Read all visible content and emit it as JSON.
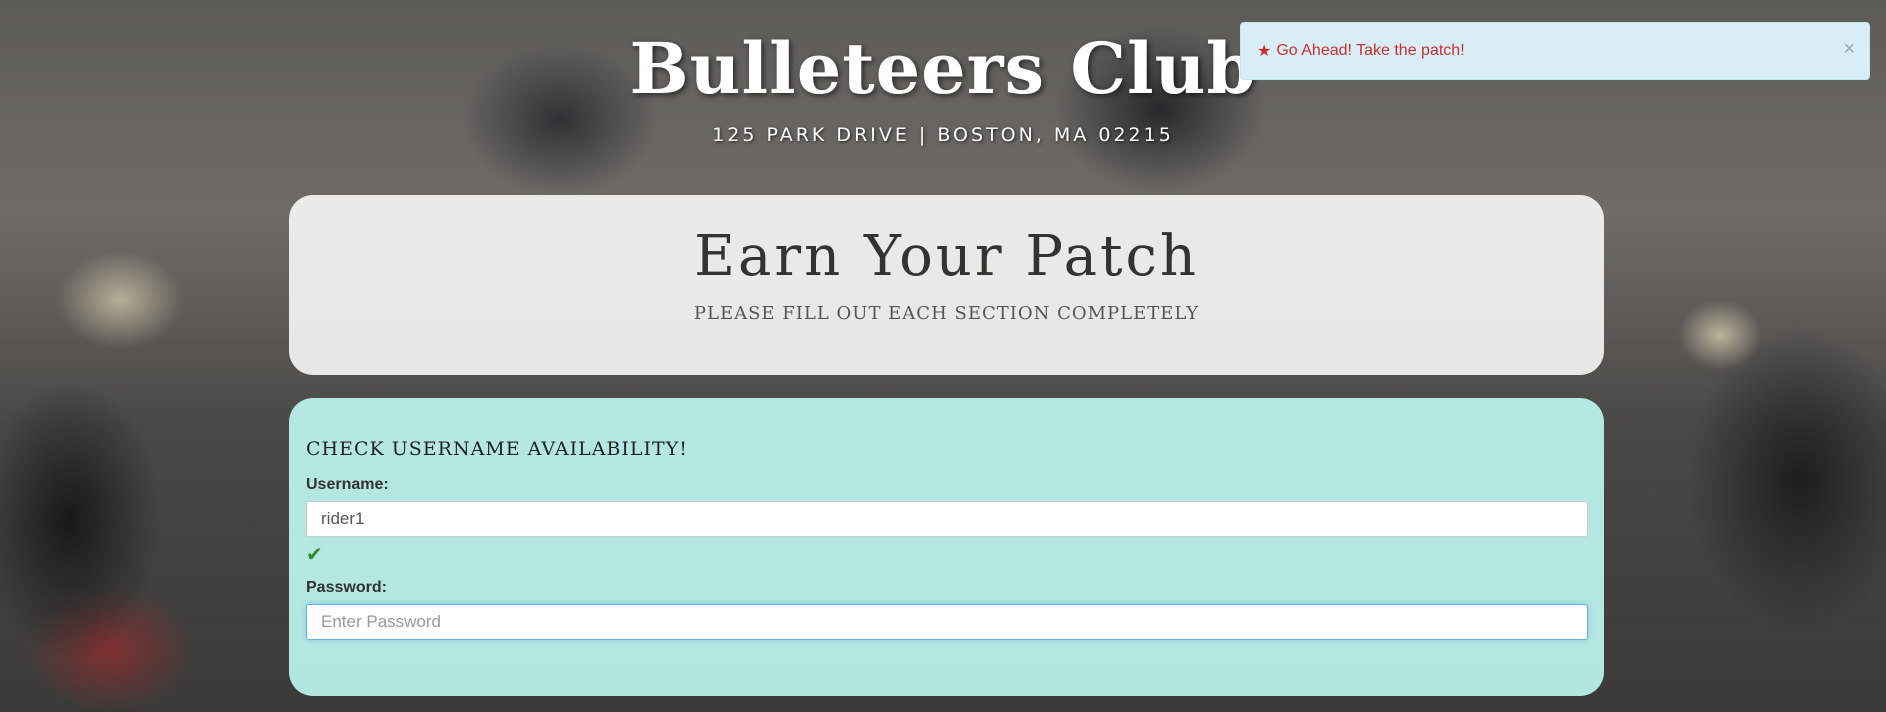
{
  "header": {
    "title": "Bulleteers Club",
    "address": "125 PARK DRIVE | BOSTON, MA 02215"
  },
  "alert": {
    "icon": "star-icon",
    "message": "Go Ahead! Take the patch!",
    "close_label": "×",
    "color": "#c9302c",
    "background": "#d9edf7"
  },
  "intro": {
    "title": "Earn Your Patch",
    "subtitle": "PLEASE FILL OUT EACH SECTION COMPLETELY"
  },
  "form": {
    "section_title": "CHECK USERNAME AVAILABILITY!",
    "username": {
      "label": "Username:",
      "value": "rider1",
      "status_icon": "checkmark-icon",
      "status_color": "#2e8b2e"
    },
    "password": {
      "label": "Password:",
      "placeholder": "Enter Password",
      "value": ""
    }
  }
}
